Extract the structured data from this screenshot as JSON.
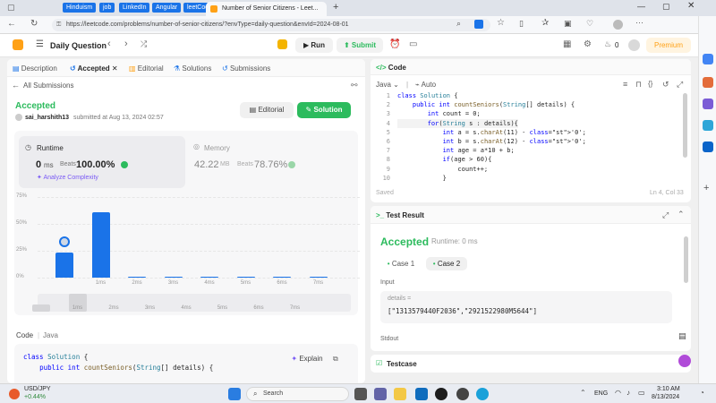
{
  "browser": {
    "bookmarks": [
      {
        "label": "Hinduism",
        "color": "#1a73e8"
      },
      {
        "label": "job",
        "color": "#1a73e8"
      },
      {
        "label": "LinkedIn",
        "color": "#1a73e8"
      },
      {
        "label": "Angular",
        "color": "#1a73e8"
      },
      {
        "label": "leetCode",
        "color": "#1a73e8"
      }
    ],
    "active_tab": "Number of Senior Citizens - Leet...",
    "new_tab": "+",
    "url": "https://leetcode.com/problems/number-of-senior-citizens/?envType=daily-question&envId=2024-08-01"
  },
  "header": {
    "daily": "Daily Question",
    "run": "Run",
    "submit": "Submit",
    "streak": "0",
    "premium": "Premium"
  },
  "left": {
    "tabs": [
      "Description",
      "Accepted",
      "Editorial",
      "Solutions",
      "Submissions"
    ],
    "all_submissions": "All Submissions",
    "status": "Accepted",
    "user": "sai_harshith13",
    "submitted": "submitted at Aug 13, 2024 02:57",
    "editorial_btn": "Editorial",
    "solution_btn": "Solution",
    "runtime_label": "Runtime",
    "runtime_value": "0",
    "runtime_unit": "ms",
    "beats_label": "Beats",
    "runtime_beats": "100.00%",
    "analyze": "Analyze Complexity",
    "memory_label": "Memory",
    "memory_value": "42.22",
    "memory_unit": "MB",
    "memory_beats": "78.76%",
    "code_label": "Code",
    "lang": "Java",
    "explain": "Explain",
    "code_preview": [
      "class Solution {",
      "    public int countSeniors(String[] details) {"
    ]
  },
  "chart_data": {
    "type": "bar",
    "categories": [
      "",
      "1ms",
      "2ms",
      "3ms",
      "4ms",
      "5ms",
      "6ms",
      "7ms"
    ],
    "values": [
      23,
      61,
      1,
      1,
      1,
      1,
      1,
      1
    ],
    "yticks": [
      "0%",
      "25%",
      "50%",
      "75%"
    ],
    "ylim": [
      0,
      75
    ],
    "mini_ticks": [
      "",
      "1ms",
      "2ms",
      "3ms",
      "4ms",
      "5ms",
      "6ms",
      "7ms"
    ]
  },
  "code": {
    "title": "Code",
    "lang": "Java",
    "mode": "Auto",
    "saved": "Saved",
    "cursor": "Ln 4, Col 33",
    "lines": [
      "class Solution {",
      "    public int countSeniors(String[] details) {",
      "        int count = 0;",
      "        for(String s : details){",
      "            int a = s.charAt(11) - '0';",
      "            int b = s.charAt(12) - '0';",
      "            int age = a*10 + b;",
      "            if(age > 60){",
      "                count++;",
      "            }"
    ],
    "line_numbers": [
      "1",
      "2",
      "3",
      "4",
      "5",
      "6",
      "7",
      "8",
      "9",
      "10"
    ]
  },
  "result": {
    "title": "Test Result",
    "status": "Accepted",
    "runtime": "Runtime: 0 ms",
    "case1": "Case 1",
    "case2": "Case 2",
    "input_label": "Input",
    "details_label": "details =",
    "details_value": "[\"1313579440F2036\",\"2921522980M5644\"]",
    "stdout_label": "Stdout",
    "testcase": "Testcase"
  },
  "taskbar": {
    "currency": "USD/JPY",
    "change": "+0.44%",
    "search": "Search",
    "lang": "ENG",
    "time": "3:10 AM",
    "date": "8/13/2024"
  }
}
